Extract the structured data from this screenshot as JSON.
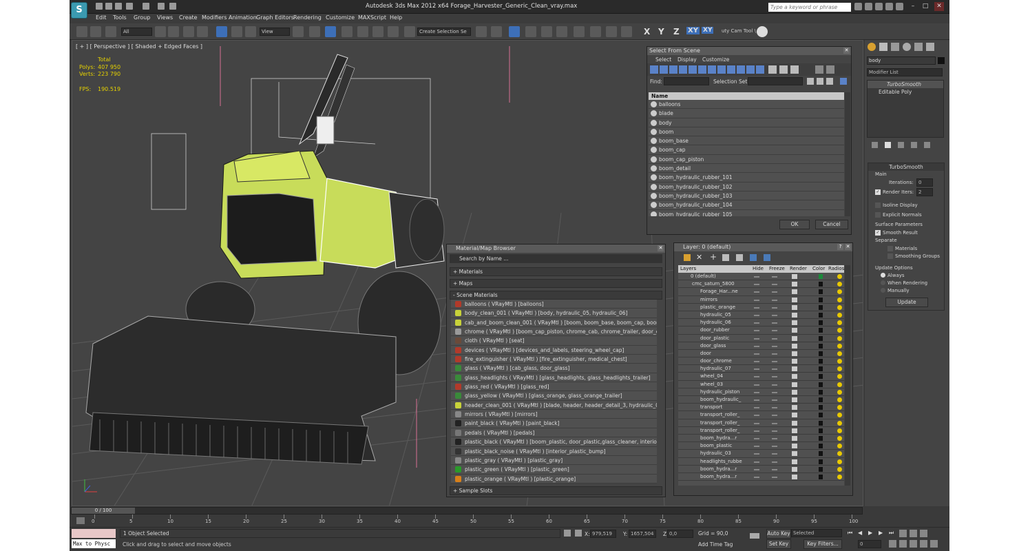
{
  "app": {
    "title": "Autodesk 3ds Max  2012 x64      Forage_Harvester_Generic_Clean_vray.max",
    "logo_letter": "S",
    "search_placeholder": "Type a keyword or phrase"
  },
  "menu": [
    "Edit",
    "Tools",
    "Group",
    "Views",
    "Create",
    "Modifiers",
    "Animation",
    "Graph Editors",
    "Rendering",
    "Customize",
    "MAXScript",
    "Help"
  ],
  "toolbar": {
    "filter": "All",
    "ref_coord": "View",
    "selection_set": "Create Selection Se",
    "axes": [
      "X",
      "Y",
      "Z",
      "XY",
      "XY"
    ],
    "cam_tool": "uty Cam Tool \\"
  },
  "viewport": {
    "label": "[ + ] [ Perspective ] [ Shaded + Edged Faces ]",
    "stats": {
      "total_label": "Total",
      "polys_label": "Polys:",
      "polys": "407 950",
      "verts_label": "Verts:",
      "verts": "223 790",
      "fps_label": "FPS:",
      "fps": "190.519"
    }
  },
  "command_panel": {
    "name_field": "body",
    "modifier_list": "Modifier List",
    "stack": [
      "TurboSmooth",
      "Editable Poly"
    ],
    "turbosmooth": {
      "title": "TurboSmooth",
      "main": "Main",
      "iterations_label": "Iterations:",
      "iterations": "0",
      "render_iters_label": "Render Iters:",
      "render_iters": "2",
      "isoline": "Isoline Display",
      "explicit": "Explicit Normals",
      "surface_params": "Surface Parameters",
      "smooth_result": "Smooth Result",
      "separate": "Separate",
      "materials": "Materials",
      "smoothing_groups": "Smoothing Groups",
      "update_options": "Update Options",
      "always": "Always",
      "when_rendering": "When Rendering",
      "manually": "Manually",
      "update_btn": "Update"
    }
  },
  "select_from_scene": {
    "title": "Select From Scene",
    "menu": [
      "Select",
      "Display",
      "Customize"
    ],
    "find_label": "Find:",
    "selection_set_label": "Selection Set:",
    "column_name": "Name",
    "items": [
      "balloons",
      "blade",
      "body",
      "boom",
      "boom_base",
      "boom_cap",
      "boom_cap_piston",
      "boom_detail",
      "boom_hydraulic_rubber_101",
      "boom_hydraulic_rubber_102",
      "boom_hydraulic_rubber_103",
      "boom_hydraulic_rubber_104",
      "boom_hydraulic_rubber_105"
    ],
    "ok": "OK",
    "cancel": "Cancel"
  },
  "material_browser": {
    "title": "Material/Map Browser",
    "search": "Search by Name ...",
    "rollouts": [
      "+ Materials",
      "+ Maps",
      "- Scene Materials",
      "+ Sample Slots"
    ],
    "materials": [
      {
        "text": "balloons  ( VRayMtl ) [balloons]",
        "color": "#b23a2a"
      },
      {
        "text": "body_clean_001  ( VRayMtl ) [body, hydraulic_05, hydraulic_06]",
        "color": "#c8d23a"
      },
      {
        "text": "cab_and_boom_clean_001  ( VRayMtl ) [boom, boom_base, boom_cap, boom_d...",
        "color": "#c8d23a"
      },
      {
        "text": "chrome  ( VRayMtl ) [boom_cap_piston, chrome_cab, chrome_trailer, door_chro...",
        "color": "#9a9a9a"
      },
      {
        "text": "cloth  ( VRayMtl ) [seat]",
        "color": "#6a4a3a"
      },
      {
        "text": "devices  ( VRayMtl ) [devices_and_labels, steering_wheel_cap]",
        "color": "#b23a2a"
      },
      {
        "text": "fire_extinguisher  ( VRayMtl ) [fire_extinguisher, medical_chest]",
        "color": "#b23a2a"
      },
      {
        "text": "glass  ( VRayMtl ) [cab_glass, door_glass]",
        "color": "#3a8a3a"
      },
      {
        "text": "glass_headlights  ( VRayMtl ) [glass_headlights, glass_headlights_trailer]",
        "color": "#3a8a3a"
      },
      {
        "text": "glass_red  ( VRayMtl ) [glass_red]",
        "color": "#b23a2a"
      },
      {
        "text": "glass_yellow  ( VRayMtl ) [glass_orange, glass_orange_trailer]",
        "color": "#3a8a3a"
      },
      {
        "text": "header_clean_001  ( VRayMtl ) [blade, header, header_detail_3, hydraulic_01, h...",
        "color": "#c8d23a"
      },
      {
        "text": "mirrors  ( VRayMtl ) [mirrors]",
        "color": "#888888"
      },
      {
        "text": "paint_black  ( VRayMtl ) [paint_black]",
        "color": "#222222"
      },
      {
        "text": "pedals  ( VRayMtl ) [pedals]",
        "color": "#777777"
      },
      {
        "text": "plastic_black  ( VRayMtl ) [boom_plastic, door_plastic,glass_cleaner, interior_pl...",
        "color": "#222222"
      },
      {
        "text": "plastic_black_noise  ( VRayMtl ) [interior_plastic_bump]",
        "color": "#333333"
      },
      {
        "text": "plastic_gray  ( VRayMtl ) [plastic_gray]",
        "color": "#888888"
      },
      {
        "text": "plastic_green  ( VRayMtl ) [plastic_green]",
        "color": "#2a9a2a"
      },
      {
        "text": "plastic_orange  ( VRayMtl ) [plastic_orange]",
        "color": "#d8801a"
      }
    ]
  },
  "layer_manager": {
    "title": "Layer: 0 (default)",
    "columns": [
      "Layers",
      "Hide",
      "Freeze",
      "Render",
      "Color",
      "Radios"
    ],
    "layers": [
      "0 (default)",
      "cmc_saturn_5800",
      "Forage_Har...ne",
      "mirrors",
      "plastic_orange",
      "hydraulic_05",
      "hydraulic_06",
      "door_rubber",
      "door_plastic",
      "door_glass",
      "door",
      "door_chrome",
      "hydraulic_07",
      "wheel_04",
      "wheel_03",
      "hydraulic_piston",
      "boom_hydraulic_",
      "transport",
      "transport_roller_",
      "transport_roller_",
      "transport_roller_",
      "boom_hydra...r",
      "boom_plastic",
      "hydraulic_03",
      "headlights_rubbe",
      "boom_hydra...r",
      "boom_hydra...r"
    ]
  },
  "timeline": {
    "frame": "0 / 100",
    "ticks": [
      "0",
      "5",
      "10",
      "15",
      "20",
      "25",
      "30",
      "35",
      "40",
      "45",
      "50",
      "55",
      "60",
      "65",
      "70",
      "75",
      "80",
      "85",
      "90",
      "95",
      "100"
    ]
  },
  "status": {
    "selected": "1 Object Selected",
    "prompt": "Click and drag to select and move objects",
    "maxscript": "Max to Physc",
    "x_label": "X:",
    "x": "979,519",
    "y_label": "Y:",
    "y": "1657,504",
    "z_label": "Z:",
    "z": "0,0",
    "grid": "Grid = 90,0",
    "auto_key": "Auto Key",
    "selected_dd": "Selected",
    "set_key": "Set Key",
    "key_filters": "Key Filters...",
    "add_time_tag": "Add Time Tag",
    "frame": "0"
  }
}
